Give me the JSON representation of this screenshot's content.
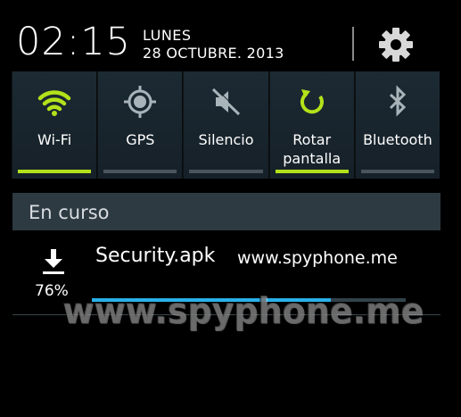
{
  "header": {
    "time": "02:15",
    "day": "LUNES",
    "date": "28 OCTUBRE. 2013",
    "settings_icon": "gear-icon"
  },
  "toggles": [
    {
      "label": "Wi-Fi",
      "icon": "wifi-icon",
      "active": true,
      "active_color": "#b2e21a"
    },
    {
      "label": "GPS",
      "icon": "gps-icon",
      "active": false
    },
    {
      "label": "Silencio",
      "icon": "mute-icon",
      "active": false
    },
    {
      "label_line1": "Rotar",
      "label_line2": "pantalla",
      "icon": "rotate-icon",
      "active": true,
      "active_color": "#b2e21a"
    },
    {
      "label": "Bluetooth",
      "icon": "bluetooth-icon",
      "active": false
    }
  ],
  "section": {
    "title": "En curso"
  },
  "notification": {
    "icon": "download-icon",
    "title": "Security.apk",
    "subtitle": "www.spyphone.me",
    "percent_label": "76%",
    "progress": 0.76,
    "progress_color": "#2ab0e8"
  },
  "watermark": "www.spyphone.me"
}
